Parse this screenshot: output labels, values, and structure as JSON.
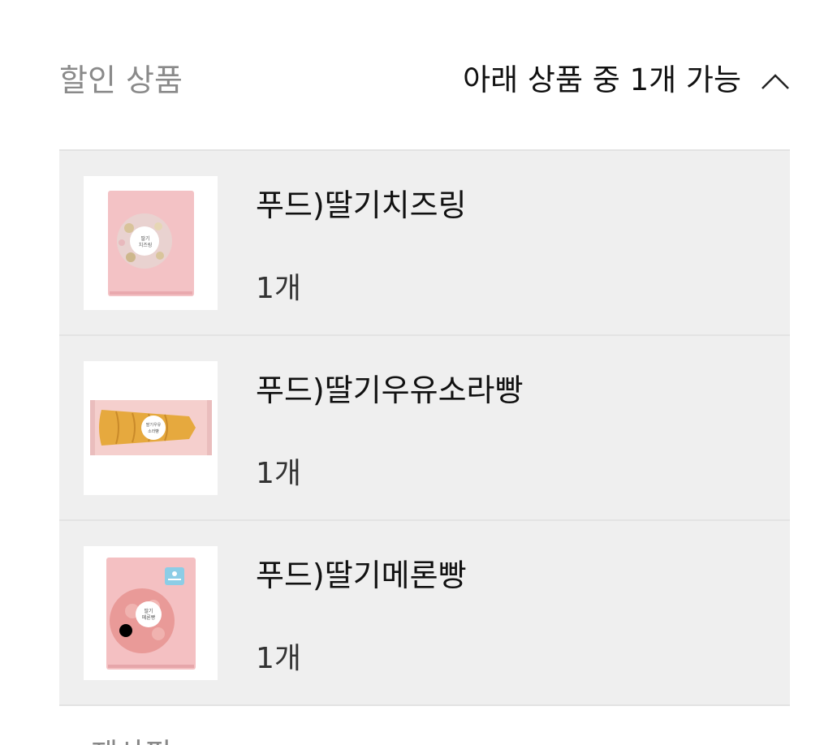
{
  "discount_section": {
    "title": "할인 상품",
    "toggle_label": "아래 상품 중 1개 가능",
    "toggle_icon": "chevron-up-icon",
    "products": [
      {
        "name": "푸드)딸기치즈링",
        "quantity": "1개",
        "image": "strawberry-cheese-ring-package"
      },
      {
        "name": "푸드)딸기우유소라빵",
        "quantity": "1개",
        "image": "strawberry-milk-cone-bread-package"
      },
      {
        "name": "푸드)딸기메론빵",
        "quantity": "1개",
        "image": "strawberry-melon-bread-package"
      }
    ]
  },
  "next_section": {
    "title_partial": "제샤핑"
  },
  "colors": {
    "list_background": "#efefef",
    "divider": "#e3e3e3",
    "package_pink": "#f4c3c6",
    "title_gray": "#8a8a8a"
  }
}
